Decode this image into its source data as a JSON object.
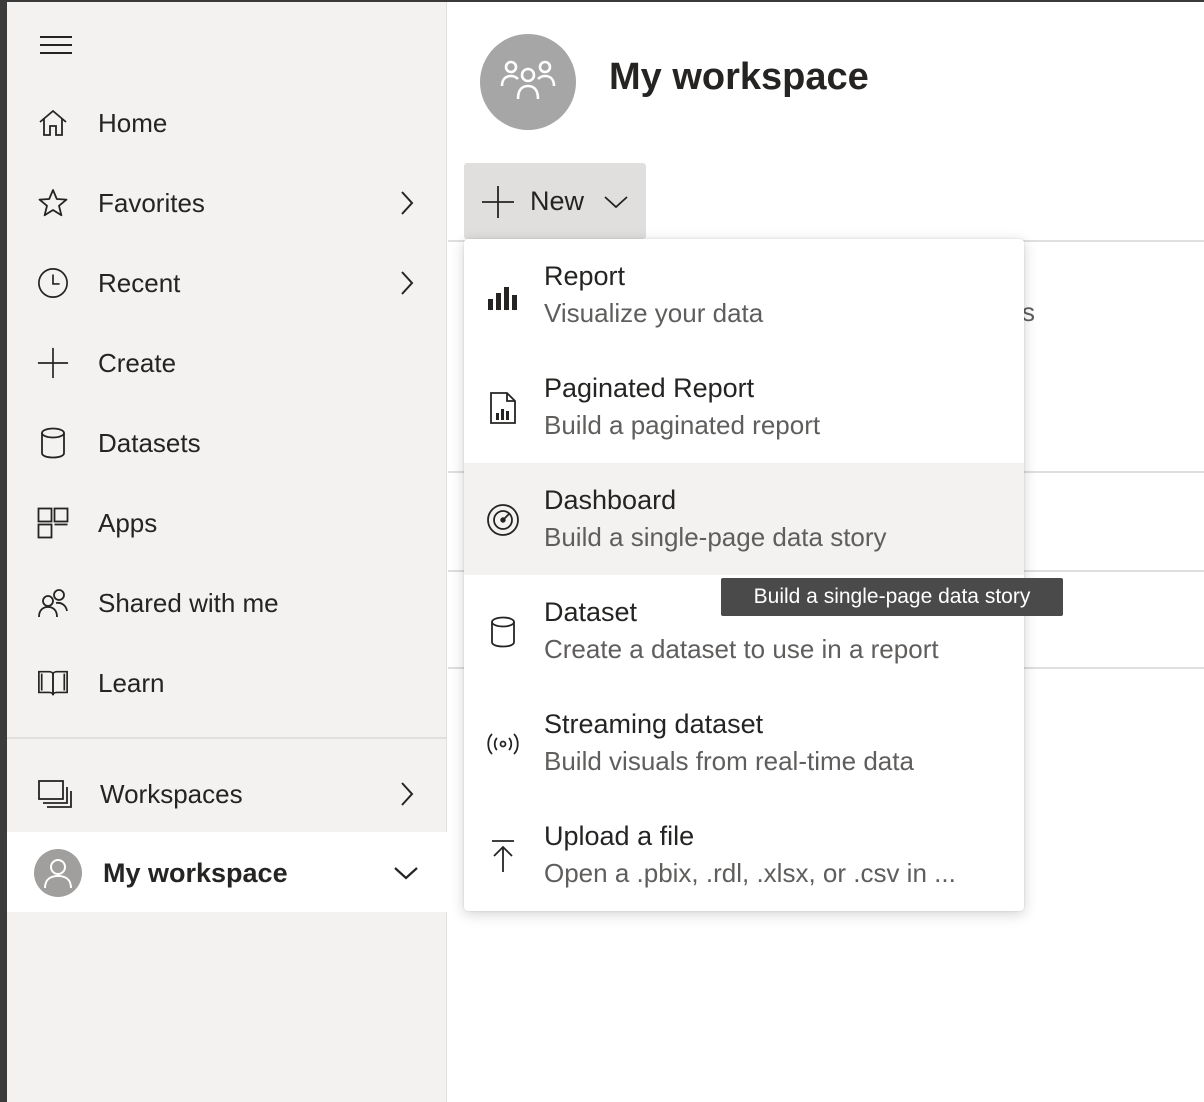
{
  "sidebar": {
    "items": [
      {
        "label": "Home",
        "icon": "home-icon"
      },
      {
        "label": "Favorites",
        "icon": "star-icon"
      },
      {
        "label": "Recent",
        "icon": "clock-icon"
      },
      {
        "label": "Create",
        "icon": "plus-icon"
      },
      {
        "label": "Datasets",
        "icon": "database-icon"
      },
      {
        "label": "Apps",
        "icon": "apps-icon"
      },
      {
        "label": "Shared with me",
        "icon": "shared-icon"
      },
      {
        "label": "Learn",
        "icon": "book-icon"
      }
    ],
    "workspaces_label": "Workspaces",
    "my_workspace_label": "My workspace"
  },
  "main": {
    "title": "My workspace",
    "new_button_label": "New",
    "background_fragment": "s"
  },
  "new_menu": {
    "items": [
      {
        "title": "Report",
        "subtitle": "Visualize your data",
        "icon": "bar-chart-icon"
      },
      {
        "title": "Paginated Report",
        "subtitle": "Build a paginated report",
        "icon": "paginated-report-icon"
      },
      {
        "title": "Dashboard",
        "subtitle": "Build a single-page data story",
        "icon": "gauge-icon"
      },
      {
        "title": "Dataset",
        "subtitle": "Create a dataset to use in a report",
        "icon": "database-icon"
      },
      {
        "title": "Streaming dataset",
        "subtitle": "Build visuals from real-time data",
        "icon": "broadcast-icon"
      },
      {
        "title": "Upload a file",
        "subtitle": "Open a .pbix, .rdl, .xlsx, or .csv in ...",
        "icon": "upload-icon"
      }
    ],
    "hovered_item": "Dashboard"
  },
  "tooltip": {
    "text": "Build a single-page data story"
  },
  "colors": {
    "sidebar_bg": "#f3f2f1",
    "hover_bg": "#f3f2f1",
    "button_bg": "#e1dfdd",
    "text": "#252423",
    "subtext": "#605e5c",
    "tooltip_bg": "#4a4a4a"
  }
}
